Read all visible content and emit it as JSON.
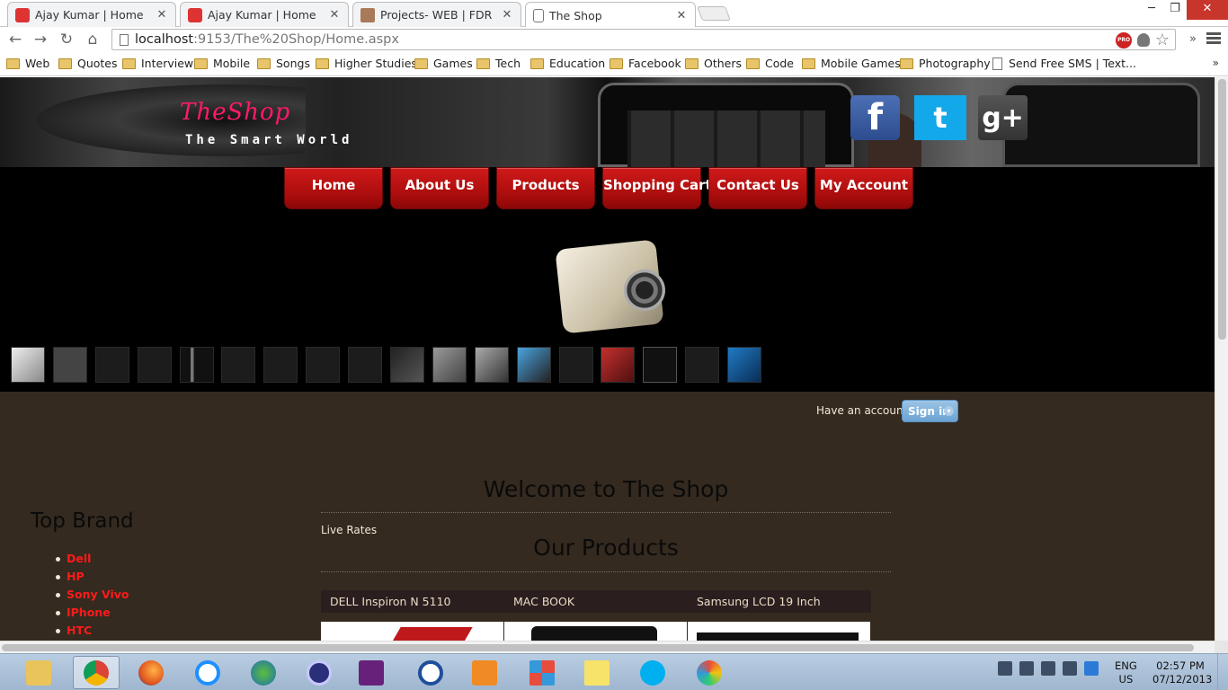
{
  "browser": {
    "tabs": [
      {
        "label": "Ajay Kumar | Home",
        "icon": "pdf-favicon-icon"
      },
      {
        "label": "Ajay Kumar | Home",
        "icon": "pdf-favicon-icon"
      },
      {
        "label": "Projects- WEB | FDR",
        "icon": "profile-favicon-icon"
      },
      {
        "label": "The Shop",
        "icon": "page-favicon-icon"
      }
    ],
    "url_host": "localhost",
    "url_path": ":9153/The%20Shop/Home.aspx",
    "pro_badge": "PRO",
    "bookmarks": [
      "Web",
      "Quotes",
      "Interview",
      "Mobile",
      "Songs",
      "Higher Studies",
      "Games",
      "Tech",
      "Education",
      "Facebook",
      "Others",
      "Code",
      "Mobile Games",
      "Photography"
    ],
    "bookmark_page": "Send Free SMS | Text...",
    "bookmark_more": "»",
    "extensions_more": "»"
  },
  "site": {
    "logo_title": "TheShop",
    "logo_subtitle": "The Smart World",
    "social": {
      "facebook": "f",
      "twitter": "t",
      "google_plus": "g+"
    },
    "menu": [
      "Home",
      "About Us",
      "Products",
      "Shopping Cart",
      "Contact Us",
      "My Account"
    ],
    "account_prompt": "Have an account?",
    "sign_in": "Sign in",
    "welcome": "Welcome to The Shop",
    "live_rates": "Live Rates",
    "our_products": "Our Products",
    "products": [
      "DELL Inspiron N 5110",
      "MAC BOOK",
      "Samsung LCD 19 Inch"
    ],
    "top_brand_title": "Top Brand",
    "brands": [
      "Dell",
      "HP",
      "Sony Vivo",
      "IPhone",
      "HTC"
    ],
    "colors": {
      "menu_red": "#c01414",
      "page_bg": "#342a1f",
      "brand_red": "#ff1a1a",
      "logo_pink": "#ff1a6a"
    }
  },
  "taskbar": {
    "lang_top": "ENG",
    "lang_bottom": "US",
    "time": "02:57 PM",
    "date": "07/12/2013",
    "apps": [
      "explorer-icon",
      "chrome-icon",
      "firefox-icon",
      "internet-explorer-icon",
      "earth-icon",
      "bittorrent-icon",
      "visual-studio-icon",
      "cyberlink-icon",
      "media-player-icon",
      "apps-grid-icon",
      "sticky-notes-icon",
      "skype-icon",
      "paint-icon"
    ]
  }
}
